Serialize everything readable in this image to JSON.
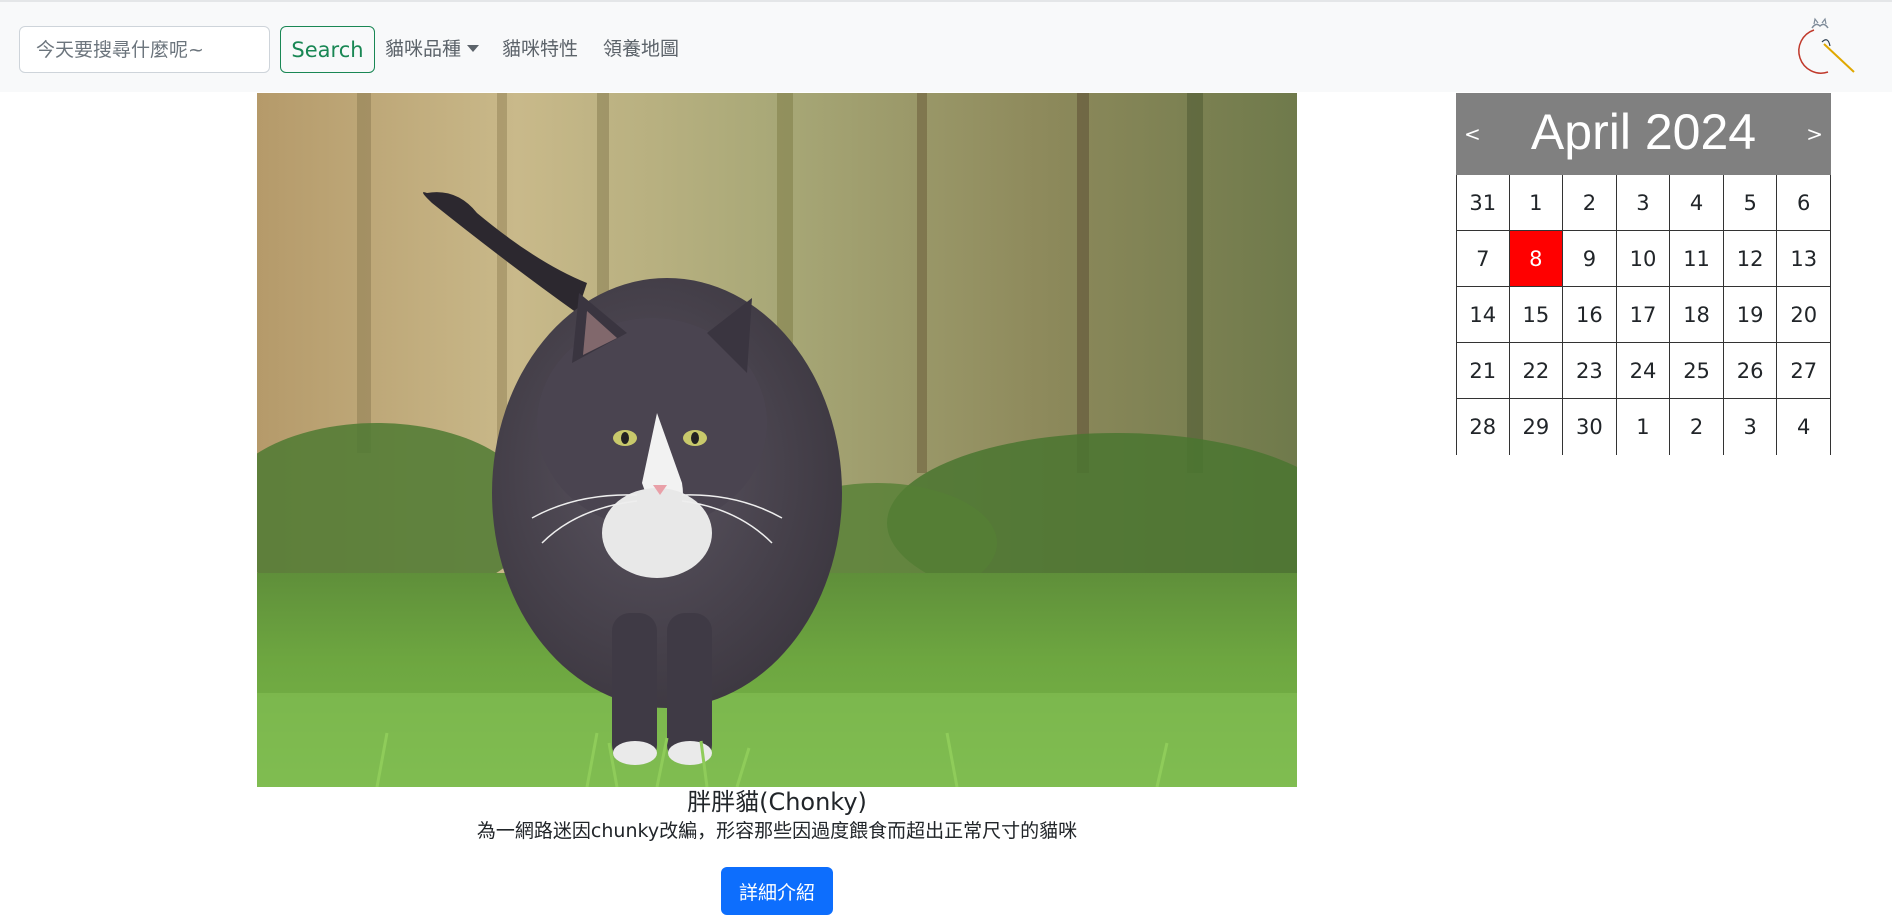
{
  "navbar": {
    "search_placeholder": "今天要搜尋什麼呢~",
    "search_button": "Search",
    "links": [
      "貓咪品種",
      "貓咪特性",
      "領養地圖"
    ]
  },
  "main": {
    "image_alt": "胖胖貓",
    "title": "胖胖貓(Chonky)",
    "description": "為一網路迷因chunky改編，形容那些因過度餵食而超出正常尺寸的貓咪",
    "detail_button": "詳細介紹"
  },
  "calendar": {
    "prev": "<",
    "next": ">",
    "title": "April 2024",
    "header_color": "#808080",
    "today_color": "#ff0000",
    "today": "8",
    "days": [
      "31",
      "1",
      "2",
      "3",
      "4",
      "5",
      "6",
      "7",
      "8",
      "9",
      "10",
      "11",
      "12",
      "13",
      "14",
      "15",
      "16",
      "17",
      "18",
      "19",
      "20",
      "21",
      "22",
      "23",
      "24",
      "25",
      "26",
      "27",
      "28",
      "29",
      "30",
      "1",
      "2",
      "3",
      "4"
    ]
  }
}
